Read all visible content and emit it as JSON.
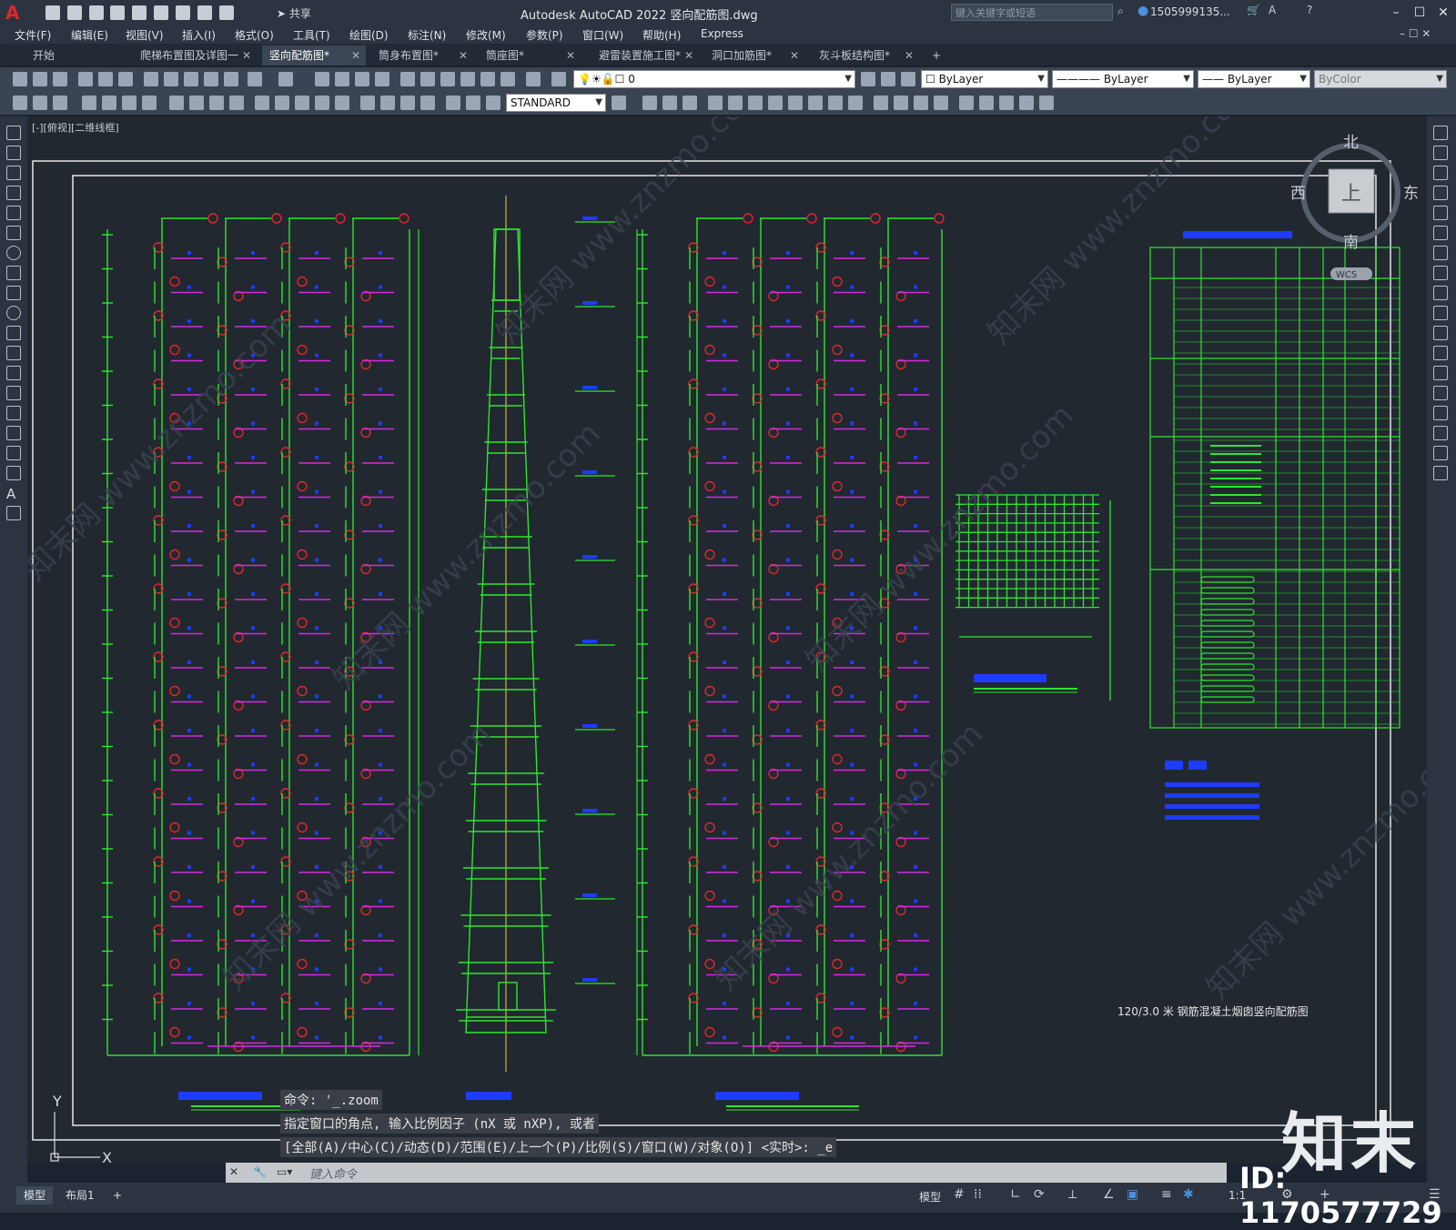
{
  "app": {
    "title": "Autodesk AutoCAD 2022    竖向配筋图.dwg",
    "share_label": "共享",
    "search_placeholder": "键入关键字或短语",
    "user": "1505999135..."
  },
  "menu": [
    "文件(F)",
    "编辑(E)",
    "视图(V)",
    "插入(I)",
    "格式(O)",
    "工具(T)",
    "绘图(D)",
    "标注(N)",
    "修改(M)",
    "参数(P)",
    "窗口(W)",
    "帮助(H)",
    "Express"
  ],
  "tabs": [
    {
      "label": "开始",
      "active": false,
      "closable": false
    },
    {
      "label": "爬梯布置图及详图一",
      "active": false,
      "closable": true
    },
    {
      "label": "竖向配筋图*",
      "active": true,
      "closable": true
    },
    {
      "label": "筒身布置图*",
      "active": false,
      "closable": true
    },
    {
      "label": "筒座图*",
      "active": false,
      "closable": true
    },
    {
      "label": "避雷装置施工图*",
      "active": false,
      "closable": true
    },
    {
      "label": "洞口加筋图*",
      "active": false,
      "closable": true
    },
    {
      "label": "灰斗板结构图*",
      "active": false,
      "closable": true
    }
  ],
  "toolbar": {
    "layer_value": "0",
    "color_value": "ByLayer",
    "linetype_value": "ByLayer",
    "lineweight_value": "ByLayer",
    "plotstyle_value": "ByColor",
    "textstyle_value": "STANDARD"
  },
  "viewport": {
    "label": "[-][俯视][二维线框]",
    "viewcube": {
      "north": "北",
      "south": "南",
      "east": "东",
      "west": "西",
      "face": "上",
      "wcs": "WCS"
    },
    "ucs_y": "Y",
    "ucs_x": "X",
    "drawing_title": "120/3.0 米 钢筋混凝土烟囱竖向配筋图"
  },
  "command": {
    "history": [
      "命令: '_.zoom",
      "指定窗口的角点, 输入比例因子 (nX 或 nXP), 或者",
      "[全部(A)/中心(C)/动态(D)/范围(E)/上一个(P)/比例(S)/窗口(W)/对象(O)] <实时>: _e"
    ],
    "input_placeholder": "键入命令"
  },
  "status": {
    "layout_tabs": [
      "模型",
      "布局1"
    ],
    "model_label": "模型",
    "scale": "1:1"
  },
  "watermark": {
    "brand": "知末",
    "id": "ID: 1170577729",
    "site_text": "知末网 www.znzmo.com"
  }
}
